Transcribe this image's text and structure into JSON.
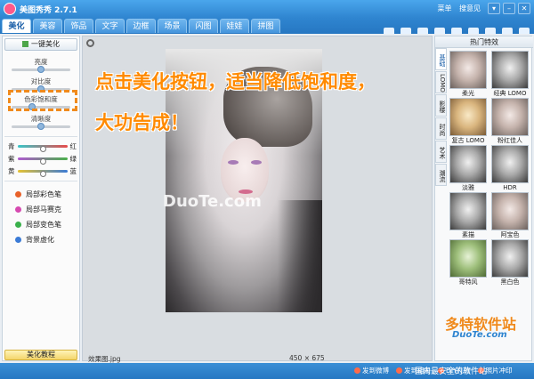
{
  "window": {
    "title": "美图秀秀 2.7.1",
    "links": [
      "菜单",
      "搜意见"
    ],
    "controls": [
      "▾",
      "–",
      "✕"
    ]
  },
  "tabs": [
    "美化",
    "美容",
    "饰品",
    "文字",
    "边框",
    "场景",
    "闪图",
    "娃娃",
    "拼图"
  ],
  "active_tab": "美化",
  "toolbar": [
    "打开",
    "保存",
    "新建",
    "拍图",
    "裁剪",
    "截图",
    "尺寸",
    "涂鸦",
    "边解"
  ],
  "left": {
    "onekey": "一键美化",
    "brightness": {
      "label": "亮度",
      "value": 0.5
    },
    "contrast": {
      "label": "对比度",
      "value": 0.5
    },
    "saturation": {
      "label": "色彩饱和度",
      "value": 0.35
    },
    "sharpness": {
      "label": "清晰度",
      "value": 0.5
    },
    "colors": [
      {
        "left": "青",
        "right": "红",
        "value": 0.5,
        "gradient": "linear-gradient(90deg,#38c6c8,#e84a4a)"
      },
      {
        "left": "紫",
        "right": "绿",
        "value": 0.5,
        "gradient": "linear-gradient(90deg,#b05ad0,#4bb04b)"
      },
      {
        "left": "黄",
        "right": "蓝",
        "value": 0.5,
        "gradient": "linear-gradient(90deg,#e6c232,#3b7bd6)"
      }
    ],
    "local_tools": [
      {
        "label": "局部彩色笔",
        "color": "#e8622a"
      },
      {
        "label": "局部马赛克",
        "color": "#d64ab0"
      },
      {
        "label": "局部变色笔",
        "color": "#3ab04b"
      },
      {
        "label": "背景虚化",
        "color": "#3b7bd6"
      }
    ],
    "tutorial": "美化教程"
  },
  "instruction": [
    "点击美化按钮，适当降低饱和度，",
    "大功告成！"
  ],
  "canvas": {
    "watermark": "DuoTe.com",
    "file_label": "效果图.jpg",
    "dimensions": "450 × 675"
  },
  "right": {
    "title": "热门特效",
    "vtabs": [
      "基础",
      "LOMO",
      "影楼",
      "时尚",
      "艺术",
      "潮流"
    ],
    "effects": [
      {
        "label": "柔光",
        "style": ""
      },
      {
        "label": "经典 LOMO",
        "style": "bw"
      },
      {
        "label": "复古 LOMO",
        "style": "warm"
      },
      {
        "label": "粉红佳人",
        "style": ""
      },
      {
        "label": "淡雅",
        "style": "bw"
      },
      {
        "label": "HDR",
        "style": "bw"
      },
      {
        "label": "素描",
        "style": "bw"
      },
      {
        "label": "阿宝色",
        "style": ""
      },
      {
        "label": "哥特风",
        "style": "green"
      },
      {
        "label": "黑白色",
        "style": "bw"
      }
    ]
  },
  "logo": {
    "big": "多特软件站",
    "url": "DuoTe.com"
  },
  "bottom": {
    "links": [
      "发到微博",
      "发到相册",
      "DIY礼物",
      "照片冲印"
    ],
    "slogan": "国内最安全的软件站"
  }
}
